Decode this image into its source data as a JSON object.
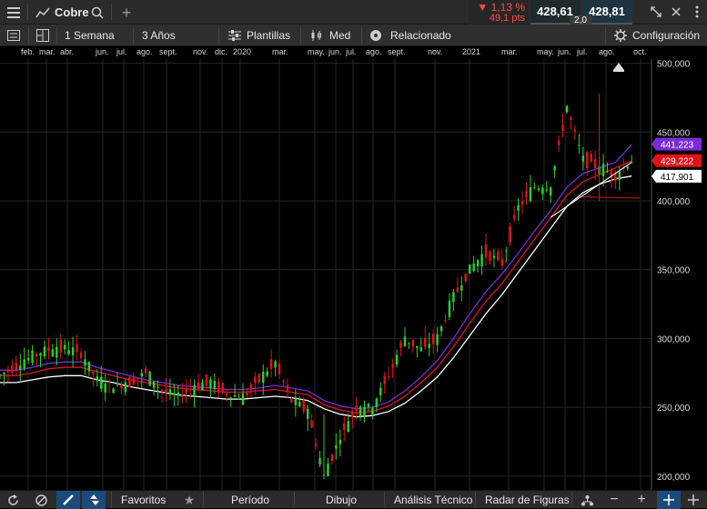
{
  "topbar": {
    "instrument": "Cobre",
    "change_pct": "▼ 1,13 %",
    "change_pts": "49,1 pts",
    "sell_price": "428,61",
    "buy_price": "428,81",
    "spread": "2,0",
    "colors": {
      "down": "#ff4b4b",
      "sell_bg": "#1f2a2a",
      "buy_bg": "#1e3540"
    }
  },
  "toolbar": {
    "interval": "1 Semana",
    "range": "3 Años",
    "templates": "Plantillas",
    "style": "Med",
    "related": "Relacionado",
    "settings": "Configuración"
  },
  "bottombar": {
    "favorites": "Favoritos",
    "period": "Período",
    "drawing": "Dibujo",
    "technical": "Análisis Técnico",
    "patterns": "Radar de Figuras"
  },
  "chart_data": {
    "type": "candlestick",
    "time_axis_labels": [
      "feb.",
      "mar.",
      "abr.",
      "jun.",
      "jul.",
      "ago.",
      "sept.",
      "nov.",
      "dic.",
      "2020",
      "mar.",
      "may.",
      "jun.",
      "jul.",
      "ago.",
      "sept.",
      "nov.",
      "2021",
      "mar.",
      "may.",
      "jun.",
      "jul.",
      "ago.",
      "oct."
    ],
    "y_ticks": [
      "200,000",
      "250,000",
      "300,000",
      "350,000",
      "400,000",
      "450,000",
      "500,000"
    ],
    "ylim": [
      190,
      505
    ],
    "price_labels": [
      {
        "text": "441,223",
        "color": "#7b2bd6"
      },
      {
        "text": "429,222",
        "color": "#e0131b"
      },
      {
        "text": "417,901",
        "color": "#ffffff"
      }
    ],
    "x_weeks": [
      0,
      4,
      8,
      12,
      16,
      20,
      24,
      28,
      32,
      36,
      40,
      44,
      48,
      52,
      56,
      60,
      64,
      68,
      72,
      76,
      80,
      84,
      88,
      92,
      96,
      100,
      104,
      108,
      112,
      116,
      120,
      124,
      128,
      132,
      136,
      140,
      144,
      148,
      152,
      156
    ],
    "close": [
      273,
      280,
      287,
      292,
      293,
      289,
      270,
      265,
      268,
      275,
      262,
      258,
      265,
      268,
      260,
      257,
      270,
      282,
      255,
      248,
      200,
      228,
      250,
      250,
      273,
      300,
      292,
      300,
      330,
      350,
      362,
      355,
      395,
      410,
      410,
      468,
      430,
      425,
      418,
      429
    ],
    "ma_short": [
      277,
      277,
      279,
      282,
      283,
      283,
      279,
      276,
      273,
      270,
      268,
      266,
      265,
      264,
      263,
      263,
      264,
      266,
      264,
      262,
      255,
      251,
      249,
      250,
      254,
      262,
      272,
      284,
      300,
      318,
      334,
      347,
      362,
      378,
      393,
      410,
      420,
      424,
      428,
      441
    ],
    "ma_mid": [
      273,
      273,
      275,
      278,
      279,
      279,
      276,
      273,
      270,
      268,
      266,
      264,
      263,
      262,
      261,
      261,
      262,
      263,
      261,
      259,
      252,
      248,
      246,
      247,
      251,
      258,
      268,
      279,
      294,
      311,
      327,
      340,
      356,
      372,
      388,
      404,
      414,
      419,
      424,
      429
    ],
    "ma_long": [
      268,
      268,
      270,
      272,
      273,
      273,
      270,
      268,
      265,
      263,
      261,
      259,
      258,
      257,
      256,
      256,
      257,
      258,
      257,
      255,
      249,
      245,
      243,
      244,
      247,
      253,
      262,
      272,
      286,
      302,
      318,
      332,
      348,
      364,
      380,
      396,
      406,
      412,
      416,
      418
    ],
    "trendlines": [
      {
        "from": [
          136,
          388
        ],
        "to": [
          156,
          428
        ],
        "color": "#ffffff"
      },
      {
        "from": [
          144,
          403
        ],
        "to": [
          158,
          402
        ],
        "color": "#e0131b"
      }
    ],
    "series": [
      {
        "name": "",
        "color": "#7b2bd6"
      },
      {
        "name": "",
        "color": "#e0131b"
      },
      {
        "name": "",
        "color": "#ffffff"
      }
    ],
    "grid": true,
    "candle_colors": {
      "up": "#2ad02a",
      "down": "#e0131b"
    }
  }
}
